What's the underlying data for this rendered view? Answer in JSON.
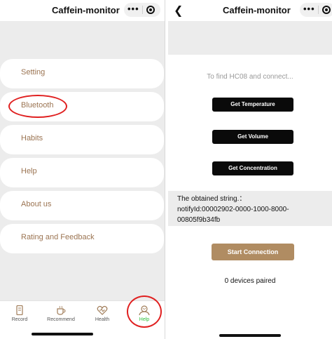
{
  "left": {
    "title": "Caffein-monitor",
    "menu": [
      {
        "label": "Setting"
      },
      {
        "label": "Bluetooth"
      },
      {
        "label": "Habits"
      },
      {
        "label": "Help"
      },
      {
        "label": "About us"
      },
      {
        "label": "Rating and Feedback"
      }
    ],
    "tabs": [
      {
        "label": "Record",
        "icon": "record-icon"
      },
      {
        "label": "Recommend",
        "icon": "coffee-cup-icon"
      },
      {
        "label": "Health",
        "icon": "heart-icon"
      },
      {
        "label": "Help",
        "icon": "user-help-icon",
        "active": true
      }
    ],
    "highlight_color": "#e02020"
  },
  "right": {
    "title": "Caffein-monitor",
    "status": "To find HC08 and connect...",
    "buttons": [
      "Get Temperature",
      "Get Volume",
      "Get Concentration"
    ],
    "result_lines": [
      "The obtained string.：",
      "notifyId:00002902-0000-1000-8000-",
      "00805f9b34fb"
    ],
    "start_button": "Start Connection",
    "paired": "0 devices paired"
  },
  "colors": {
    "menu_text": "#9b7452",
    "accent_button": "#b08c62",
    "active_tab": "#2cbf3a"
  }
}
